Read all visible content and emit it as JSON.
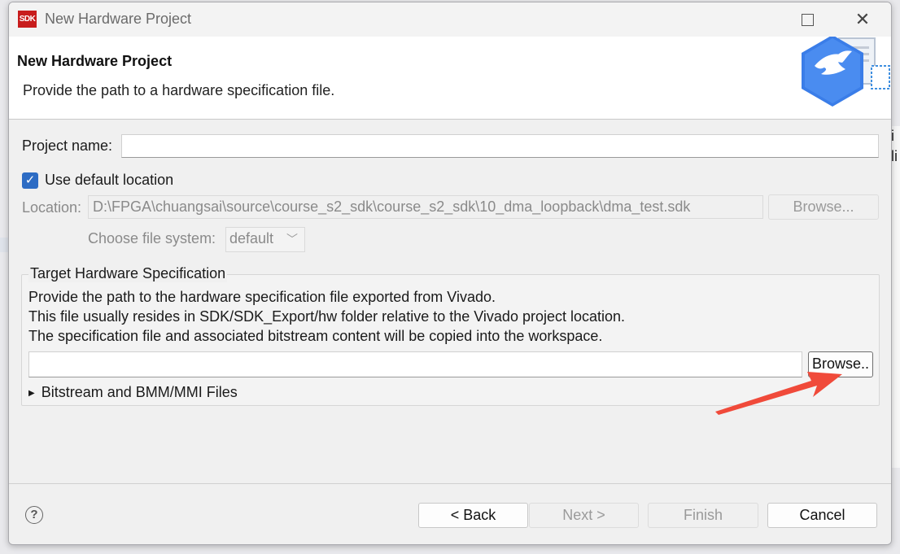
{
  "window": {
    "app_logo_text": "SDK",
    "title": "New Hardware Project"
  },
  "banner": {
    "title": "New Hardware Project",
    "description": "Provide the path to a hardware specification file."
  },
  "form": {
    "project_name_label": "Project name:",
    "project_name_value": "",
    "use_default_label": "Use default location",
    "use_default_checked": true,
    "location_label": "Location:",
    "location_value": "D:\\FPGA\\chuangsai\\source\\course_s2_sdk\\course_s2_sdk\\10_dma_loopback\\dma_test.sdk",
    "location_browse_label": "Browse...",
    "file_system_label": "Choose file system:",
    "file_system_value": "default"
  },
  "target_group": {
    "title": "Target Hardware Specification",
    "line1": "Provide the path to the hardware specification file exported from Vivado.",
    "line2": "This file usually resides in SDK/SDK_Export/hw folder relative to the Vivado project location.",
    "line3": "The specification file and associated bitstream content will be copied into the workspace.",
    "spec_path_value": "",
    "browse_label": "Browse..",
    "expander_label": "Bitstream and BMM/MMI Files"
  },
  "footer": {
    "help_symbol": "?",
    "back_label": "< Back",
    "next_label": "Next >",
    "finish_label": "Finish",
    "cancel_label": "Cancel"
  },
  "background": {
    "right_chars": [
      "i",
      "li"
    ]
  },
  "colors": {
    "accent": "#2d6cc4",
    "annotation_arrow": "#f04a3a",
    "logo_red": "#c81c1c"
  }
}
